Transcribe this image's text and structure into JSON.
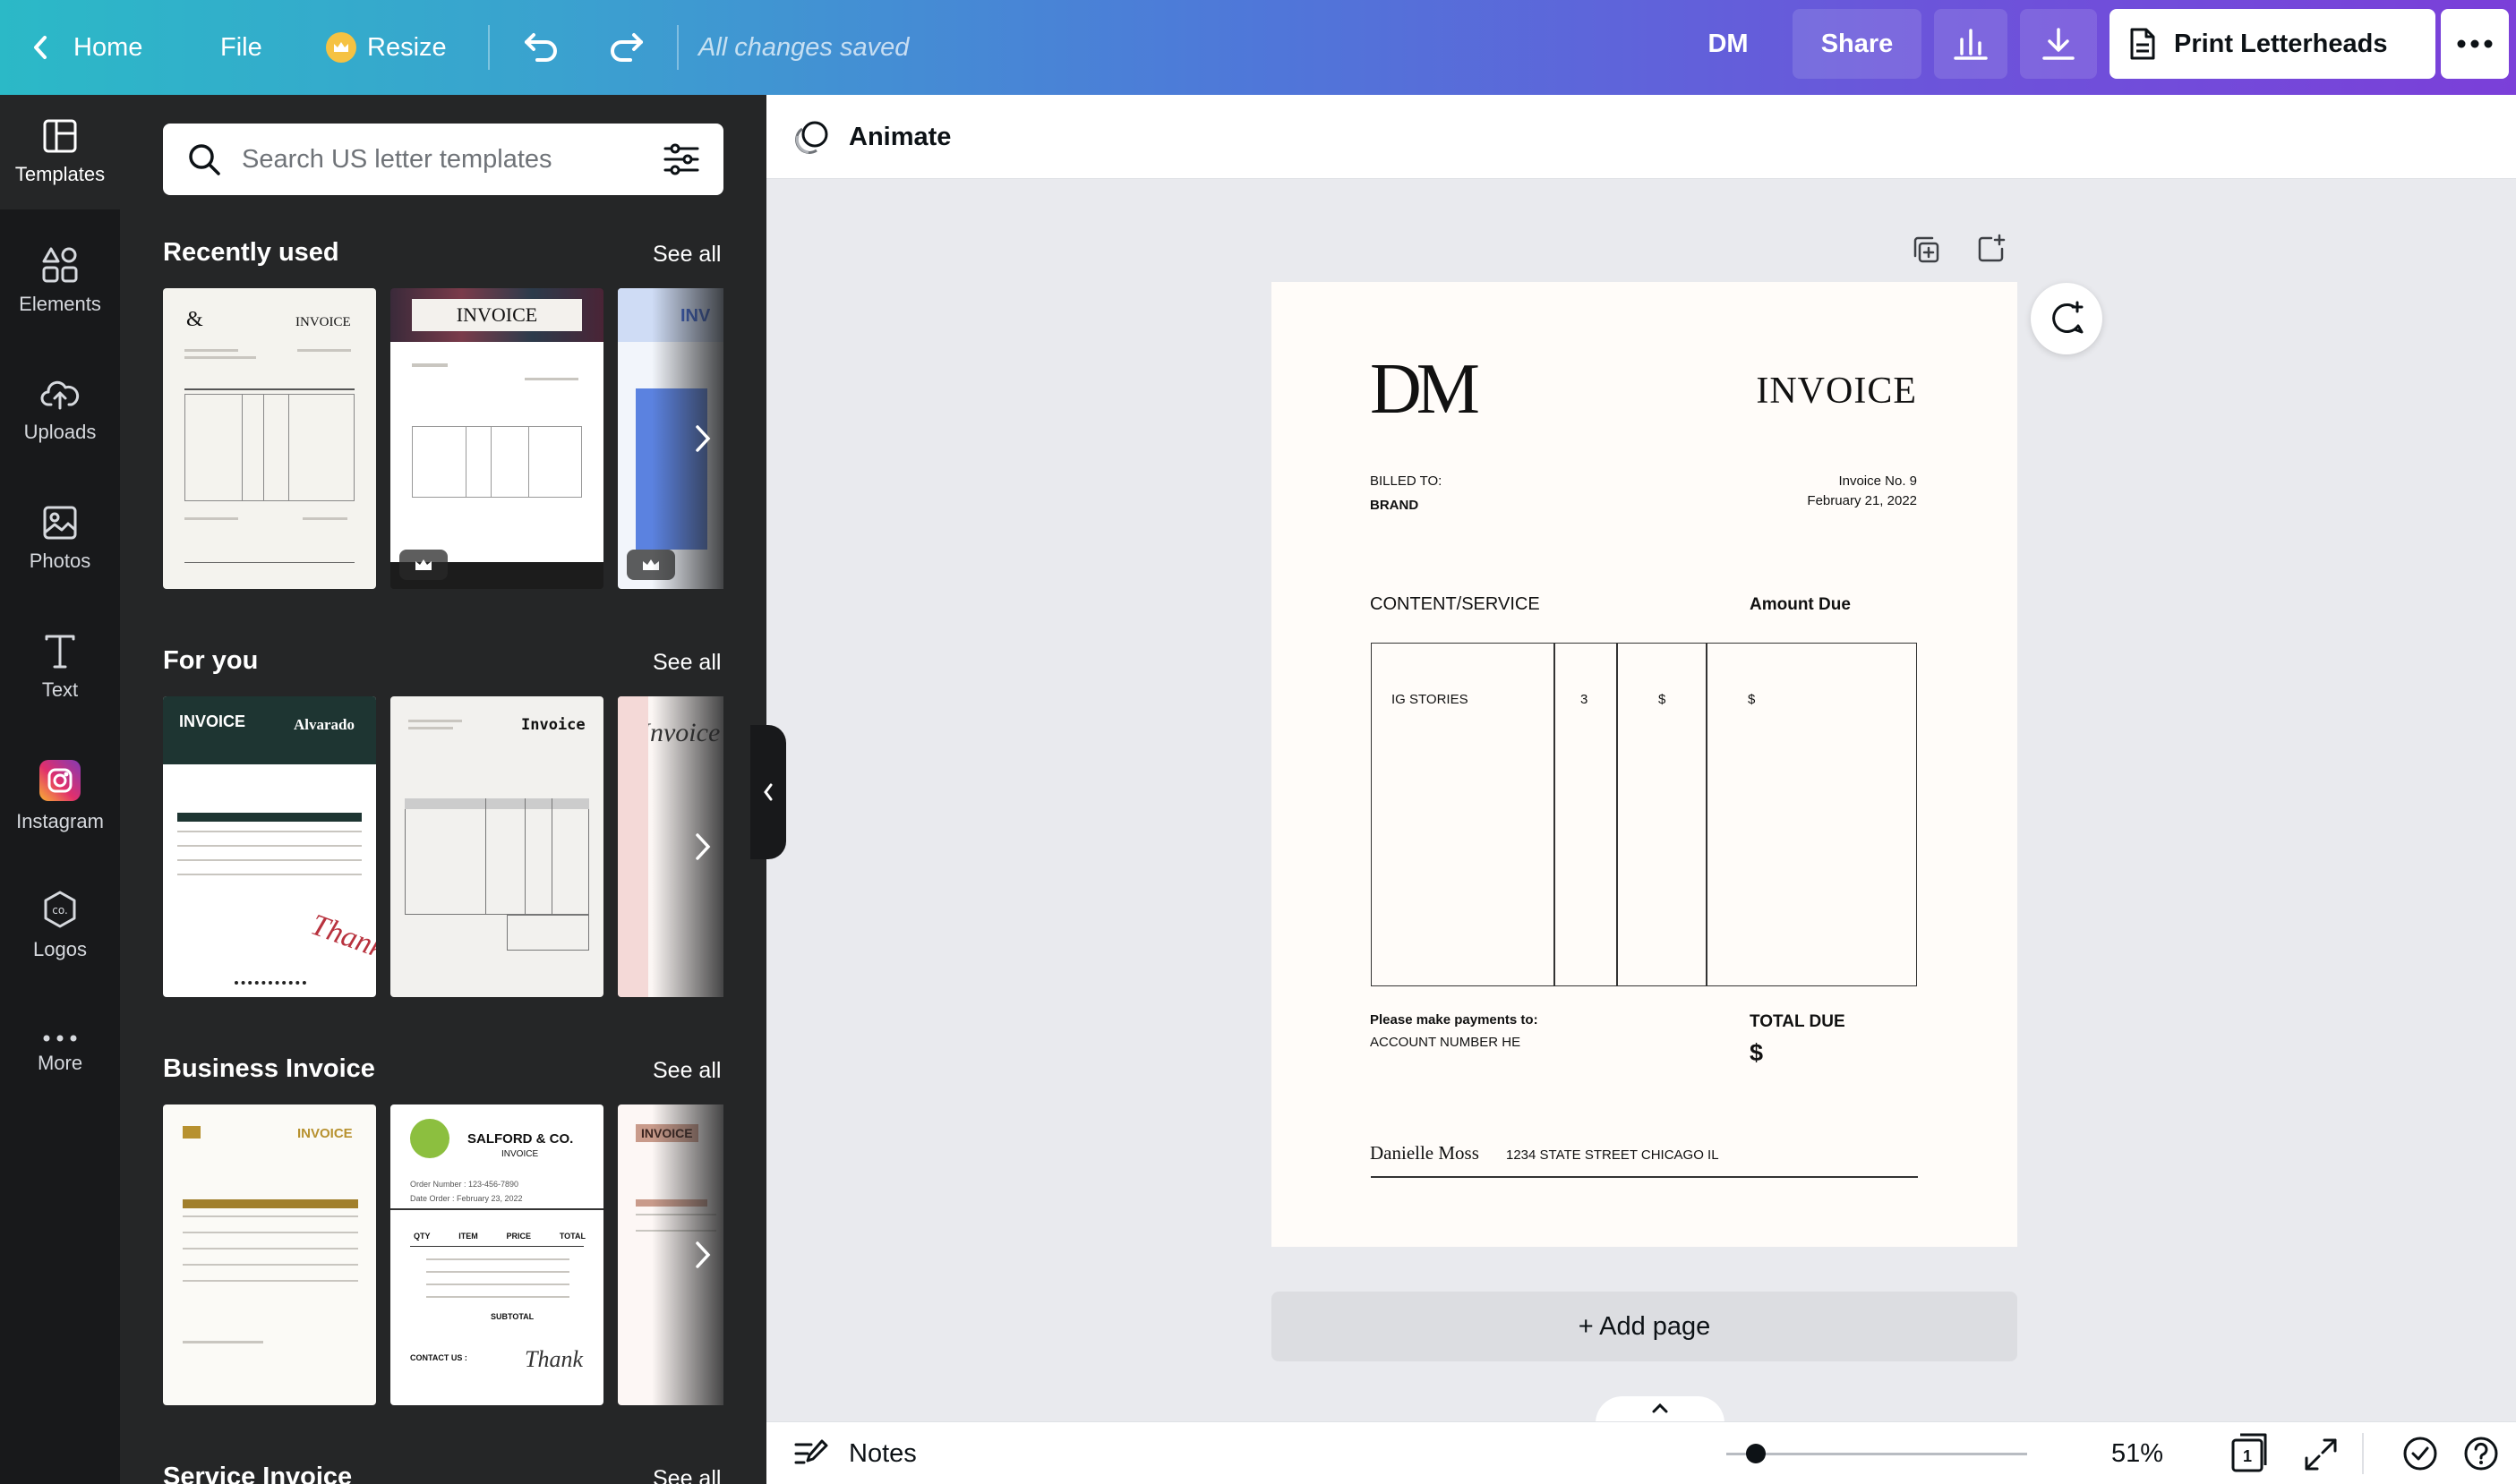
{
  "topbar": {
    "home": "Home",
    "file": "File",
    "resize": "Resize",
    "status": "All changes saved",
    "initials": "DM",
    "share": "Share",
    "print": "Print Letterheads"
  },
  "rail": {
    "items": [
      {
        "label": "Templates",
        "icon": "templates-icon"
      },
      {
        "label": "Elements",
        "icon": "elements-icon"
      },
      {
        "label": "Uploads",
        "icon": "uploads-icon"
      },
      {
        "label": "Photos",
        "icon": "photos-icon"
      },
      {
        "label": "Text",
        "icon": "text-icon"
      },
      {
        "label": "Instagram",
        "icon": "instagram-icon"
      },
      {
        "label": "Logos",
        "icon": "logos-icon"
      },
      {
        "label": "More",
        "icon": "more-icon"
      }
    ]
  },
  "panel": {
    "search_placeholder": "Search US letter templates",
    "see_all": "See all",
    "sections": [
      {
        "title": "Recently used"
      },
      {
        "title": "For you"
      },
      {
        "title": "Business Invoice"
      },
      {
        "title": "Service Invoice"
      }
    ],
    "thumbs": {
      "t1_title": "INVOICE",
      "t2_title": "INVOICE",
      "t4_title": "INVOICE",
      "t4_brand": "Alvarado",
      "t5_title": "Invoice",
      "t7_title": "INVOICE",
      "t8_title": "SALFORD & CO.",
      "t8_sub": "INVOICE",
      "t8_order": "Order Number : 123-456-7890",
      "t8_date": "Date Order : February 23, 2022",
      "t8_cols": [
        "QTY",
        "ITEM",
        "PRICE",
        "TOTAL"
      ],
      "t8_subtotal": "SUBTOTAL",
      "t8_contact": "CONTACT US :",
      "t9_title": "INVOICE"
    }
  },
  "workspace": {
    "animate": "Animate",
    "add_page": "+ Add page",
    "notes": "Notes",
    "zoom": "51%",
    "page_count": "1"
  },
  "document": {
    "logo": "DM",
    "title": "INVOICE",
    "billed_to_label": "BILLED TO:",
    "billed_to_value": "BRAND",
    "invoice_no": "Invoice No. 9",
    "invoice_date": "February 21, 2022",
    "col_service": "CONTENT/SERVICE",
    "col_amount": "Amount Due",
    "row_service": "IG STORIES",
    "row_qty": "3",
    "row_price": "$",
    "row_amount": "$",
    "payment_label": "Please make payments to:",
    "payment_value": "ACCOUNT NUMBER HE",
    "total_label": "TOTAL DUE",
    "total_value": "$",
    "signature": "Danielle Moss",
    "address": "1234 STATE STREET CHICAGO IL"
  }
}
